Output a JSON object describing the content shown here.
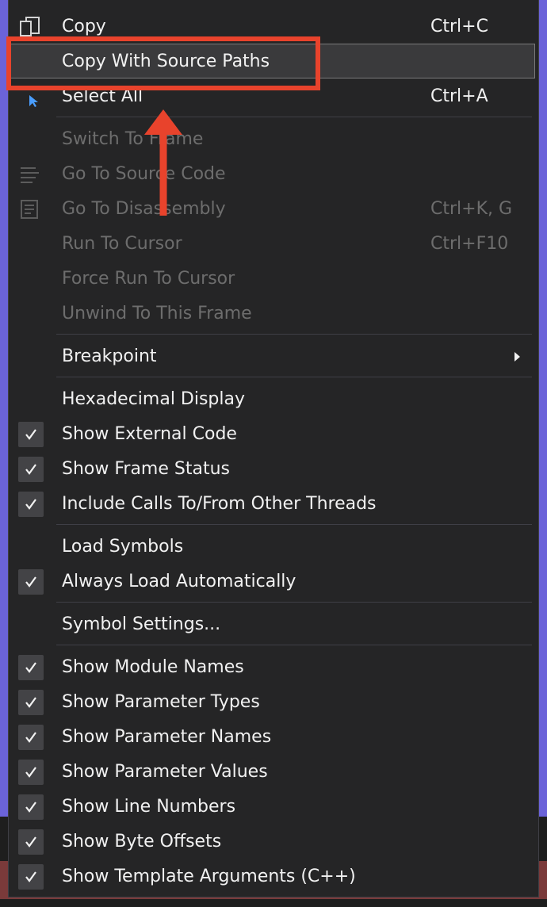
{
  "menu": {
    "items": [
      {
        "label": "Copy",
        "shortcut": "Ctrl+C",
        "state": "normal",
        "icon": "copy-icon"
      },
      {
        "label": "Copy With Source Paths",
        "shortcut": "",
        "state": "highlight"
      },
      {
        "label": "Select All",
        "shortcut": "Ctrl+A",
        "state": "normal",
        "icon": "cursor-icon"
      },
      {
        "label": "Switch To Frame",
        "shortcut": "",
        "state": "disabled"
      },
      {
        "label": "Go To Source Code",
        "shortcut": "",
        "state": "disabled",
        "icon": "source-code-icon"
      },
      {
        "label": "Go To Disassembly",
        "shortcut": "Ctrl+K, G",
        "state": "disabled",
        "icon": "disassembly-icon"
      },
      {
        "label": "Run To Cursor",
        "shortcut": "Ctrl+F10",
        "state": "disabled"
      },
      {
        "label": "Force Run To Cursor",
        "shortcut": "",
        "state": "disabled"
      },
      {
        "label": "Unwind To This Frame",
        "shortcut": "",
        "state": "disabled"
      },
      {
        "label": "Breakpoint",
        "shortcut": "",
        "state": "normal",
        "submenu": true
      },
      {
        "label": "Hexadecimal Display",
        "shortcut": "",
        "state": "normal",
        "checked": false
      },
      {
        "label": "Show External Code",
        "shortcut": "",
        "state": "normal",
        "checked": true
      },
      {
        "label": "Show Frame Status",
        "shortcut": "",
        "state": "normal",
        "checked": true
      },
      {
        "label": "Include Calls To/From Other Threads",
        "shortcut": "",
        "state": "normal",
        "checked": true
      },
      {
        "label": "Load Symbols",
        "shortcut": "",
        "state": "normal",
        "checked": false
      },
      {
        "label": "Always Load Automatically",
        "shortcut": "",
        "state": "normal",
        "checked": true
      },
      {
        "label": "Symbol Settings...",
        "shortcut": "",
        "state": "normal",
        "checked": false
      },
      {
        "label": "Show Module Names",
        "shortcut": "",
        "state": "normal",
        "checked": true
      },
      {
        "label": "Show Parameter Types",
        "shortcut": "",
        "state": "normal",
        "checked": true
      },
      {
        "label": "Show Parameter Names",
        "shortcut": "",
        "state": "normal",
        "checked": true
      },
      {
        "label": "Show Parameter Values",
        "shortcut": "",
        "state": "normal",
        "checked": true
      },
      {
        "label": "Show Line Numbers",
        "shortcut": "",
        "state": "normal",
        "checked": true
      },
      {
        "label": "Show Byte Offsets",
        "shortcut": "",
        "state": "normal",
        "checked": true
      },
      {
        "label": "Show Template Arguments (C++)",
        "shortcut": "",
        "state": "normal",
        "checked": true
      }
    ]
  },
  "colors": {
    "menu_bg": "#252526",
    "text": "#f1f1f1",
    "disabled_text": "#6d6d6d",
    "annotation": "#e8432c",
    "background_accent": "#6b63d9"
  }
}
